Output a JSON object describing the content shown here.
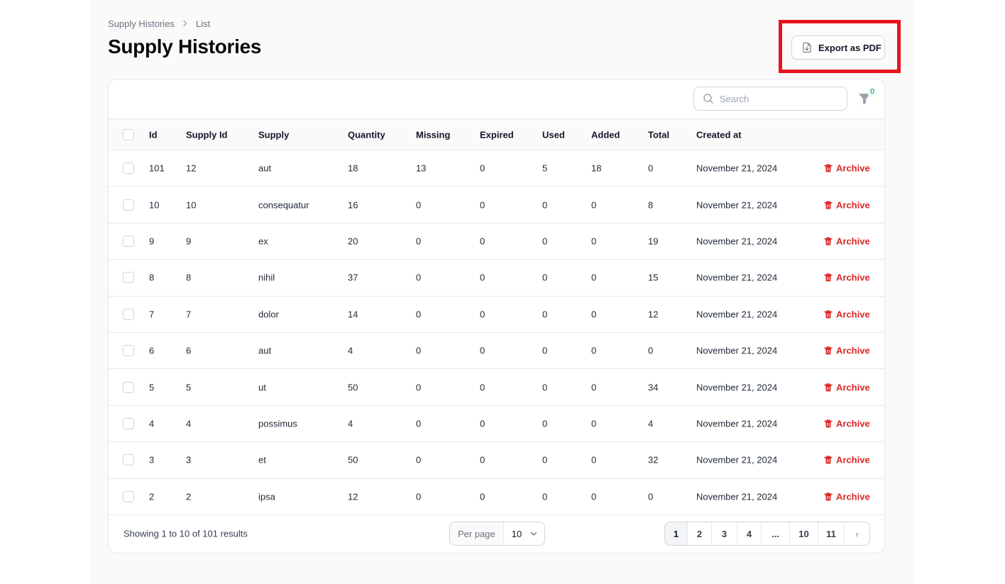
{
  "breadcrumb": {
    "parent": "Supply Histories",
    "current": "List"
  },
  "page_title": "Supply Histories",
  "export_button": "Export as PDF",
  "search": {
    "placeholder": "Search"
  },
  "filter_count": "0",
  "columns": {
    "id": "Id",
    "supply_id": "Supply Id",
    "supply": "Supply",
    "quantity": "Quantity",
    "missing": "Missing",
    "expired": "Expired",
    "used": "Used",
    "added": "Added",
    "total": "Total",
    "created_at": "Created at"
  },
  "rows": [
    {
      "id": "101",
      "supply_id": "12",
      "supply": "aut",
      "quantity": "18",
      "missing": "13",
      "expired": "0",
      "used": "5",
      "added": "18",
      "total": "0",
      "created_at": "November 21, 2024",
      "action": "Archive"
    },
    {
      "id": "10",
      "supply_id": "10",
      "supply": "consequatur",
      "quantity": "16",
      "missing": "0",
      "expired": "0",
      "used": "0",
      "added": "0",
      "total": "8",
      "created_at": "November 21, 2024",
      "action": "Archive"
    },
    {
      "id": "9",
      "supply_id": "9",
      "supply": "ex",
      "quantity": "20",
      "missing": "0",
      "expired": "0",
      "used": "0",
      "added": "0",
      "total": "19",
      "created_at": "November 21, 2024",
      "action": "Archive"
    },
    {
      "id": "8",
      "supply_id": "8",
      "supply": "nihil",
      "quantity": "37",
      "missing": "0",
      "expired": "0",
      "used": "0",
      "added": "0",
      "total": "15",
      "created_at": "November 21, 2024",
      "action": "Archive"
    },
    {
      "id": "7",
      "supply_id": "7",
      "supply": "dolor",
      "quantity": "14",
      "missing": "0",
      "expired": "0",
      "used": "0",
      "added": "0",
      "total": "12",
      "created_at": "November 21, 2024",
      "action": "Archive"
    },
    {
      "id": "6",
      "supply_id": "6",
      "supply": "aut",
      "quantity": "4",
      "missing": "0",
      "expired": "0",
      "used": "0",
      "added": "0",
      "total": "0",
      "created_at": "November 21, 2024",
      "action": "Archive"
    },
    {
      "id": "5",
      "supply_id": "5",
      "supply": "ut",
      "quantity": "50",
      "missing": "0",
      "expired": "0",
      "used": "0",
      "added": "0",
      "total": "34",
      "created_at": "November 21, 2024",
      "action": "Archive"
    },
    {
      "id": "4",
      "supply_id": "4",
      "supply": "possimus",
      "quantity": "4",
      "missing": "0",
      "expired": "0",
      "used": "0",
      "added": "0",
      "total": "4",
      "created_at": "November 21, 2024",
      "action": "Archive"
    },
    {
      "id": "3",
      "supply_id": "3",
      "supply": "et",
      "quantity": "50",
      "missing": "0",
      "expired": "0",
      "used": "0",
      "added": "0",
      "total": "32",
      "created_at": "November 21, 2024",
      "action": "Archive"
    },
    {
      "id": "2",
      "supply_id": "2",
      "supply": "ipsa",
      "quantity": "12",
      "missing": "0",
      "expired": "0",
      "used": "0",
      "added": "0",
      "total": "0",
      "created_at": "November 21, 2024",
      "action": "Archive"
    }
  ],
  "footer": {
    "showing": "Showing 1 to 10 of 101 results",
    "per_page_label": "Per page",
    "per_page_value": "10"
  },
  "pagination": [
    {
      "label": "1",
      "active": true
    },
    {
      "label": "2"
    },
    {
      "label": "3"
    },
    {
      "label": "4"
    },
    {
      "label": "..."
    },
    {
      "label": "10"
    },
    {
      "label": "11"
    },
    {
      "label": "›"
    }
  ],
  "colors": {
    "accent_danger": "#dc2626",
    "highlight": "#e8151f"
  }
}
